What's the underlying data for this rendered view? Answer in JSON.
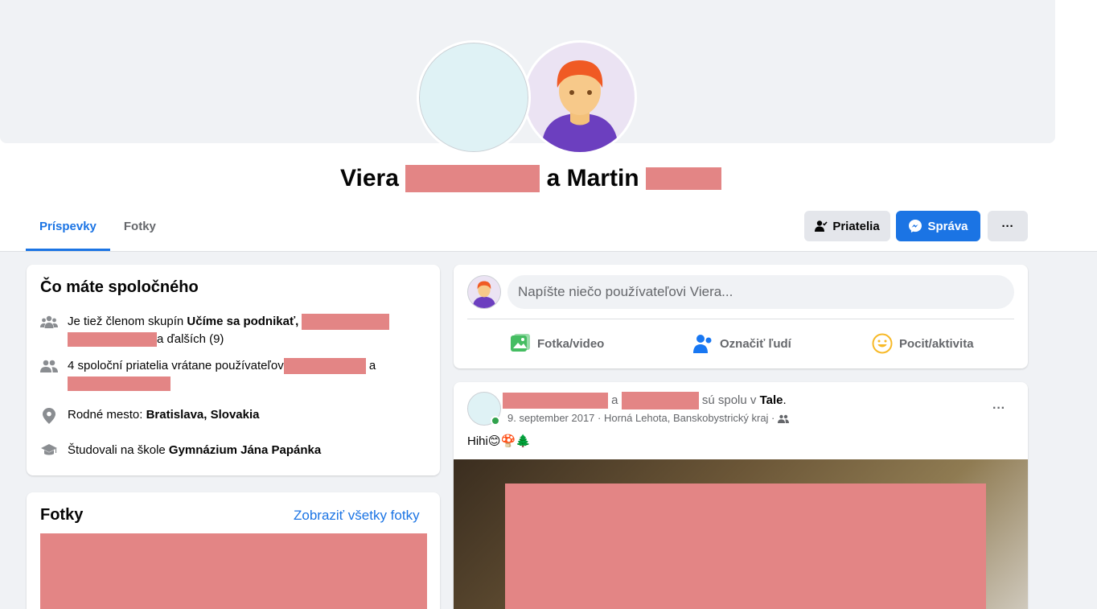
{
  "profile": {
    "name_first": "Viera",
    "name_join": "a Martin"
  },
  "tabs": [
    {
      "label": "Príspevky",
      "active": true
    },
    {
      "label": "Fotky",
      "active": false
    }
  ],
  "buttons": {
    "friends": "Priatelia",
    "message": "Správa",
    "more": "···"
  },
  "common": {
    "title": "Čo máte spoločného",
    "groups_prefix": "Je tiež členom skupín ",
    "groups_name": "Učíme sa podnikať,",
    "groups_more": "a ďalších (9)",
    "friends_text": "4 spoloční priatelia vrátane používateľov",
    "friends_and": "a",
    "hometown_prefix": "Rodné mesto: ",
    "hometown_value": "Bratislava, Slovakia",
    "school_prefix": "Študovali na škole ",
    "school_value": "Gymnázium Jána Papánka"
  },
  "photos": {
    "title": "Fotky",
    "see_all": "Zobraziť všetky fotky"
  },
  "composer": {
    "placeholder": "Napíšte niečo používateľovi Viera...",
    "actions": [
      "Fotka/video",
      "Označiť ľudí",
      "Pocit/aktivita"
    ]
  },
  "post": {
    "and": "a",
    "together": "sú spolu v",
    "place": "Tale",
    "period": ".",
    "date_location": "9. september 2017 · Horná Lehota, Banskobystrický kraj ·",
    "text": "Hihi😊🍄🌲",
    "more": "···"
  },
  "colors": {
    "accent": "#1b74e4",
    "redaction": "#e38585",
    "icon_gray": "#65676b"
  }
}
